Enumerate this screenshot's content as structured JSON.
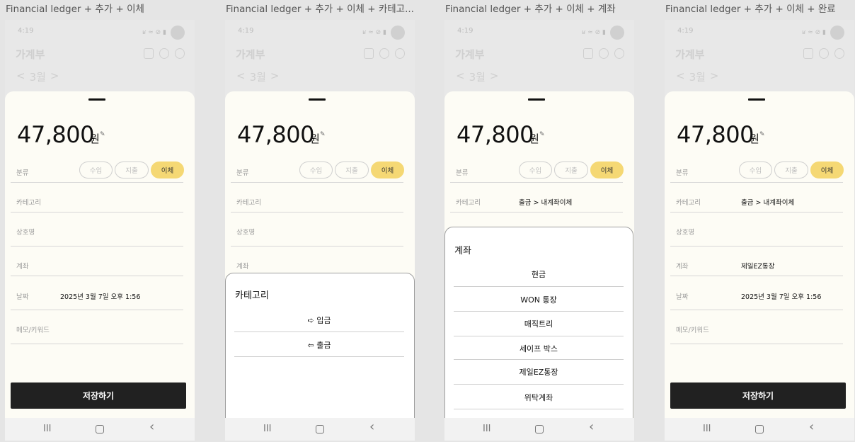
{
  "frames": [
    {
      "label": "Financial ledger + 추가 + 이체"
    },
    {
      "label": "Financial ledger + 추가 + 이체 + 카테고..."
    },
    {
      "label": "Financial ledger + 추가 + 이체 + 계좌"
    },
    {
      "label": "Financial ledger + 추가 + 이체 + 완료"
    }
  ],
  "status_bar": {
    "time": "4:19",
    "icons": "ʁ ≈ ⊘ ▮"
  },
  "app": {
    "title": "가계부",
    "month_prev": "<",
    "month": "3월",
    "month_next": ">",
    "header_icons": [
      "bar-chart-icon",
      "bell-icon",
      "user-icon"
    ]
  },
  "sheet": {
    "amount": "47,800",
    "currency": "원",
    "type_label": "분류",
    "type_options": [
      "수입",
      "지출",
      "이체"
    ],
    "type_selected": "이체",
    "category_label": "카테고리",
    "merchant_label": "상호명",
    "account_label": "계좌",
    "date_label": "날짜",
    "memo_label": "메모/키워드",
    "date_value": "2025년 3월 7일 오후 1:56",
    "category_value_selected": "출금 > 내계좌이체",
    "account_value_selected": "제일EZ통장",
    "save_label": "저장하기"
  },
  "category_popup": {
    "title": "카테고리",
    "options": [
      "➪ 입금",
      "⇦ 출금"
    ]
  },
  "account_popup": {
    "title": "계좌",
    "options": [
      "현금",
      "WON 통장",
      "매직트리",
      "세이프 박스",
      "제일EZ통장",
      "위탁계좌"
    ]
  },
  "nav": {
    "recents": "III",
    "back": "‹"
  },
  "colors": {
    "accent": "#f5d874",
    "sheet_bg": "#fdfcf5",
    "button_dark": "#212121"
  }
}
